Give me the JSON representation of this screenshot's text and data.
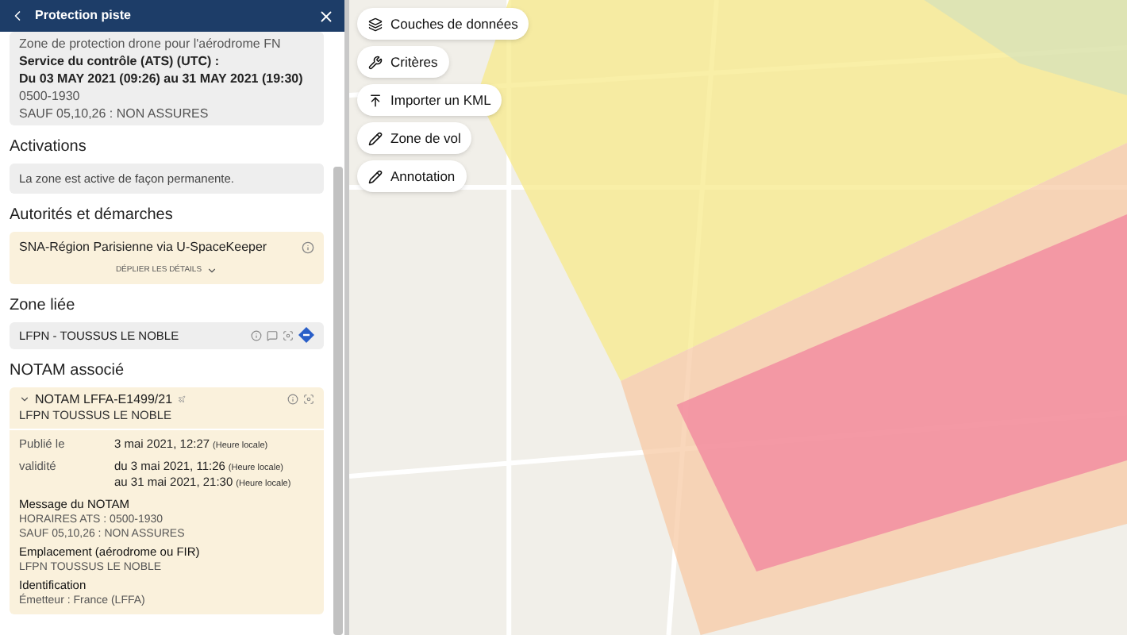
{
  "header": {
    "title": "Protection piste"
  },
  "description": {
    "lines": [
      {
        "text": "Zone de protection drone pour l'aérodrome FN",
        "bold": false
      },
      {
        "text": "Service du contrôle (ATS) (UTC) :",
        "bold": true
      },
      {
        "text": "Du 03 MAY 2021 (09:26) au 31 MAY 2021 (19:30)",
        "bold": true
      },
      {
        "text": "0500-1930",
        "bold": false
      },
      {
        "text": "SAUF 05,10,26 : NON ASSURES",
        "bold": false
      }
    ]
  },
  "activations": {
    "title": "Activations",
    "text": "La zone est active de façon permanente."
  },
  "authorities": {
    "title": "Autorités et démarches",
    "name": "SNA-Région Parisienne via U-SpaceKeeper",
    "expand_label": "DÉPLIER LES DÉTAILS",
    "expanded": false
  },
  "linked_zone": {
    "title": "Zone liée",
    "name": "LFPN - TOUSSUS LE NOBLE"
  },
  "notam": {
    "title": "NOTAM associé",
    "expanded": true,
    "id": "NOTAM LFFA-E1499/21",
    "location": "LFPN TOUSSUS LE NOBLE",
    "fields": [
      {
        "label": "Publié le",
        "values": [
          {
            "date": "3 mai 2021, 12:27",
            "note": "(Heure locale)"
          }
        ]
      },
      {
        "label": "validité",
        "values": [
          {
            "date": "du 3 mai 2021, 11:26",
            "note": "(Heure locale)"
          },
          {
            "date": "au 31 mai 2021, 21:30",
            "note": "(Heure locale)"
          }
        ]
      }
    ],
    "blocks": [
      {
        "title": "Message du NOTAM",
        "lines": [
          "HORAIRES ATS : 0500-1930",
          "SAUF 05,10,26 : NON ASSURES"
        ]
      },
      {
        "title": "Emplacement (aérodrome ou FIR)",
        "lines": [
          "LFPN  TOUSSUS LE NOBLE"
        ]
      },
      {
        "title": "Identification",
        "lines": [
          "Émetteur : France (LFFA)"
        ]
      }
    ]
  },
  "map_buttons": [
    {
      "label": "Couches de données",
      "kind": "layers"
    },
    {
      "label": "Critères",
      "kind": "wrench"
    },
    {
      "label": "Importer un KML",
      "kind": "upload"
    },
    {
      "label": "Zone de vol",
      "kind": "pencil"
    },
    {
      "label": "Annotation",
      "kind": "pencil"
    }
  ]
}
